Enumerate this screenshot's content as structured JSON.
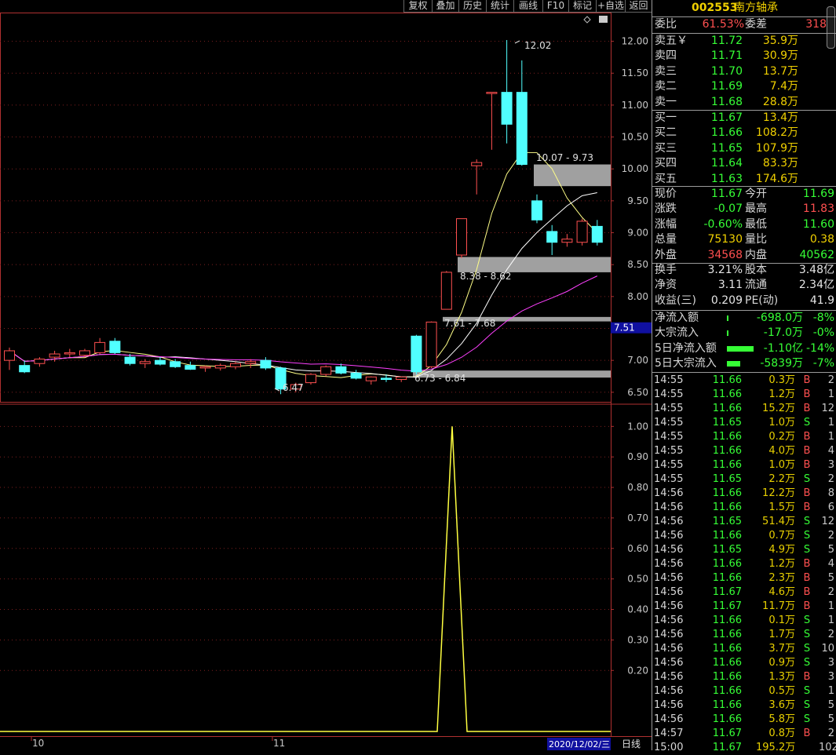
{
  "toolbar": {
    "buttons": [
      "复权",
      "叠加",
      "历史",
      "统计",
      "画线",
      "F10",
      "标记",
      "+自选",
      "返回"
    ]
  },
  "chart_data": [
    {
      "type": "candlestick",
      "y_ticks": [
        "12.00",
        "11.50",
        "11.00",
        "10.50",
        "10.00",
        "9.50",
        "9.00",
        "8.50",
        "8.00",
        "7.50",
        "7.00",
        "6.50"
      ],
      "ylim": [
        6.35,
        12.45
      ],
      "x_labels": [
        "10",
        "11"
      ],
      "candles": [
        {
          "o": 7.0,
          "h": 7.2,
          "l": 6.85,
          "c": 7.15
        },
        {
          "o": 6.92,
          "h": 7.0,
          "l": 6.8,
          "c": 6.82
        },
        {
          "o": 6.95,
          "h": 7.05,
          "l": 6.9,
          "c": 7.02
        },
        {
          "o": 7.05,
          "h": 7.15,
          "l": 6.98,
          "c": 7.1
        },
        {
          "o": 7.1,
          "h": 7.18,
          "l": 7.05,
          "c": 7.12
        },
        {
          "o": 7.08,
          "h": 7.18,
          "l": 7.05,
          "c": 7.15
        },
        {
          "o": 7.12,
          "h": 7.35,
          "l": 7.1,
          "c": 7.28
        },
        {
          "o": 7.3,
          "h": 7.35,
          "l": 7.1,
          "c": 7.12
        },
        {
          "o": 7.05,
          "h": 7.1,
          "l": 6.92,
          "c": 6.95
        },
        {
          "o": 6.95,
          "h": 7.02,
          "l": 6.88,
          "c": 6.98
        },
        {
          "o": 7.0,
          "h": 7.05,
          "l": 6.92,
          "c": 6.94
        },
        {
          "o": 6.98,
          "h": 7.02,
          "l": 6.88,
          "c": 6.9
        },
        {
          "o": 6.92,
          "h": 6.98,
          "l": 6.85,
          "c": 6.86
        },
        {
          "o": 6.88,
          "h": 6.92,
          "l": 6.82,
          "c": 6.9
        },
        {
          "o": 6.88,
          "h": 6.95,
          "l": 6.84,
          "c": 6.92
        },
        {
          "o": 6.9,
          "h": 6.98,
          "l": 6.86,
          "c": 6.95
        },
        {
          "o": 6.95,
          "h": 7.02,
          "l": 6.88,
          "c": 6.98
        },
        {
          "o": 7.0,
          "h": 7.05,
          "l": 6.85,
          "c": 6.88
        },
        {
          "o": 6.88,
          "h": 6.9,
          "l": 6.47,
          "c": 6.55
        },
        {
          "o": 6.55,
          "h": 6.65,
          "l": 6.5,
          "c": 6.62
        },
        {
          "o": 6.65,
          "h": 6.8,
          "l": 6.62,
          "c": 6.78
        },
        {
          "o": 6.78,
          "h": 6.92,
          "l": 6.75,
          "c": 6.9
        },
        {
          "o": 6.9,
          "h": 6.95,
          "l": 6.78,
          "c": 6.8
        },
        {
          "o": 6.8,
          "h": 6.85,
          "l": 6.7,
          "c": 6.72
        },
        {
          "o": 6.68,
          "h": 6.75,
          "l": 6.62,
          "c": 6.74
        },
        {
          "o": 6.72,
          "h": 6.78,
          "l": 6.66,
          "c": 6.7
        },
        {
          "o": 6.7,
          "h": 6.75,
          "l": 6.66,
          "c": 6.74
        },
        {
          "o": 7.38,
          "h": 7.4,
          "l": 6.78,
          "c": 6.82
        },
        {
          "o": 6.9,
          "h": 7.61,
          "l": 6.88,
          "c": 7.6
        },
        {
          "o": 7.8,
          "h": 8.4,
          "l": 7.8,
          "c": 8.38
        },
        {
          "o": 8.65,
          "h": 9.22,
          "l": 8.6,
          "c": 9.22
        },
        {
          "o": 10.05,
          "h": 10.15,
          "l": 9.6,
          "c": 10.1
        },
        {
          "o": 11.2,
          "h": 11.2,
          "l": 10.3,
          "c": 11.2
        },
        {
          "o": 11.2,
          "h": 12.02,
          "l": 10.4,
          "c": 10.7
        },
        {
          "o": 11.2,
          "h": 11.7,
          "l": 10.05,
          "c": 10.07
        },
        {
          "o": 9.5,
          "h": 9.6,
          "l": 9.15,
          "c": 9.2
        },
        {
          "o": 9.02,
          "h": 9.12,
          "l": 8.65,
          "c": 8.85
        },
        {
          "o": 8.85,
          "h": 8.98,
          "l": 8.78,
          "c": 8.9
        },
        {
          "o": 8.85,
          "h": 9.22,
          "l": 8.8,
          "c": 9.18
        },
        {
          "o": 9.1,
          "h": 9.2,
          "l": 8.8,
          "c": 8.85
        }
      ],
      "annotations": [
        "12.02",
        "10.07 - 9.73",
        "8.38 - 8.62",
        "7.61 - 7.68",
        "6.73 - 6.84",
        "6.47"
      ],
      "zones": [
        {
          "low": 9.73,
          "high": 10.07
        },
        {
          "low": 8.38,
          "high": 8.62
        },
        {
          "low": 7.61,
          "high": 7.68
        },
        {
          "low": 6.73,
          "high": 6.84
        }
      ],
      "current_price_label": "7.51"
    },
    {
      "type": "line",
      "y_ticks": [
        "1.00",
        "0.90",
        "0.80",
        "0.70",
        "0.60",
        "0.50",
        "0.40",
        "0.30",
        "0.20"
      ],
      "ylim": [
        0,
        1.06
      ],
      "values": [
        0,
        0,
        0,
        0,
        0,
        0,
        0,
        0,
        0,
        0,
        0,
        0,
        0,
        0,
        0,
        0,
        0,
        0,
        0,
        0,
        0,
        0,
        0,
        0,
        0,
        0,
        0,
        0,
        0,
        1,
        0,
        0,
        0,
        0,
        0,
        0,
        0,
        0,
        0,
        0
      ]
    }
  ],
  "date_bar": {
    "date": "2020/12/02/三",
    "period": "日线"
  },
  "stock": {
    "code": "002553",
    "name": "南方轴承"
  },
  "weibi": {
    "label1": "委比",
    "value1": "61.53%",
    "label2": "委差",
    "value2": "318"
  },
  "sell_orders": [
    {
      "label": "卖五￥",
      "price": "11.72",
      "volume": "35.9万"
    },
    {
      "label": "卖四",
      "price": "11.71",
      "volume": "30.9万"
    },
    {
      "label": "卖三",
      "price": "11.70",
      "volume": "13.7万"
    },
    {
      "label": "卖二",
      "price": "11.69",
      "volume": "7.4万"
    },
    {
      "label": "卖一",
      "price": "11.68",
      "volume": "28.8万"
    }
  ],
  "buy_orders": [
    {
      "label": "买一",
      "price": "11.67",
      "volume": "13.4万"
    },
    {
      "label": "买二",
      "price": "11.66",
      "volume": "108.2万"
    },
    {
      "label": "买三",
      "price": "11.65",
      "volume": "107.9万"
    },
    {
      "label": "买四",
      "price": "11.64",
      "volume": "83.3万"
    },
    {
      "label": "买五",
      "price": "11.63",
      "volume": "174.6万"
    }
  ],
  "quote": [
    {
      "l1": "现价",
      "v1": "11.67",
      "c1": "green",
      "l2": "今开",
      "v2": "11.69",
      "c2": "green"
    },
    {
      "l1": "涨跌",
      "v1": "-0.07",
      "c1": "green",
      "l2": "最高",
      "v2": "11.83",
      "c2": "red"
    },
    {
      "l1": "涨幅",
      "v1": "-0.60%",
      "c1": "green",
      "l2": "最低",
      "v2": "11.60",
      "c2": "green"
    },
    {
      "l1": "总量",
      "v1": "75130",
      "c1": "yellow",
      "l2": "量比",
      "v2": "0.38",
      "c2": "yellow"
    },
    {
      "l1": "外盘",
      "v1": "34568",
      "c1": "red",
      "l2": "内盘",
      "v2": "40562",
      "c2": "green"
    }
  ],
  "fundamentals": [
    {
      "l1": "换手",
      "v1": "3.21%",
      "l2": "股本",
      "v2": "3.48亿"
    },
    {
      "l1": "净资",
      "v1": "3.11",
      "l2": "流通",
      "v2": "2.34亿"
    },
    {
      "l1": "收益(三)",
      "v1": "0.209",
      "l2": "PE(动)",
      "v2": "41.9"
    }
  ],
  "flows": [
    {
      "label": "净流入额",
      "bar": 0.02,
      "value": "-698.0万",
      "pct": "-8%"
    },
    {
      "label": "大宗流入",
      "bar": 0.01,
      "value": "-17.0万",
      "pct": "-0%"
    },
    {
      "label": "5日净流入额",
      "bar": 0.9,
      "value": "-1.10亿",
      "pct": "-14%"
    },
    {
      "label": "5日大宗流入",
      "bar": 0.45,
      "value": "-5839万",
      "pct": "-7%"
    }
  ],
  "colors": {
    "up": "#ff5050",
    "down": "#50ffff",
    "ma5": "#ffff88",
    "ma10": "#ffffff",
    "ma20": "#ff40ff"
  },
  "ticks": [
    {
      "time": "14:55",
      "price": "11.66",
      "vol": "0.3万",
      "bs": "B",
      "n": "2"
    },
    {
      "time": "14:55",
      "price": "11.66",
      "vol": "1.2万",
      "bs": "B",
      "n": "1"
    },
    {
      "time": "14:55",
      "price": "11.66",
      "vol": "15.2万",
      "bs": "B",
      "n": "12"
    },
    {
      "time": "14:55",
      "price": "11.65",
      "vol": "1.0万",
      "bs": "S",
      "n": "1"
    },
    {
      "time": "14:55",
      "price": "11.66",
      "vol": "0.2万",
      "bs": "B",
      "n": "1"
    },
    {
      "time": "14:55",
      "price": "11.66",
      "vol": "4.0万",
      "bs": "B",
      "n": "4"
    },
    {
      "time": "14:55",
      "price": "11.66",
      "vol": "1.0万",
      "bs": "B",
      "n": "3"
    },
    {
      "time": "14:55",
      "price": "11.65",
      "vol": "2.2万",
      "bs": "S",
      "n": "2"
    },
    {
      "time": "14:56",
      "price": "11.66",
      "vol": "12.2万",
      "bs": "B",
      "n": "8"
    },
    {
      "time": "14:56",
      "price": "11.66",
      "vol": "1.5万",
      "bs": "B",
      "n": "6"
    },
    {
      "time": "14:56",
      "price": "11.65",
      "vol": "51.4万",
      "bs": "S",
      "n": "12"
    },
    {
      "time": "14:56",
      "price": "11.66",
      "vol": "0.7万",
      "bs": "S",
      "n": "2"
    },
    {
      "time": "14:56",
      "price": "11.65",
      "vol": "4.9万",
      "bs": "S",
      "n": "5"
    },
    {
      "time": "14:56",
      "price": "11.66",
      "vol": "1.2万",
      "bs": "B",
      "n": "4"
    },
    {
      "time": "14:56",
      "price": "11.66",
      "vol": "2.3万",
      "bs": "B",
      "n": "5"
    },
    {
      "time": "14:56",
      "price": "11.67",
      "vol": "4.6万",
      "bs": "B",
      "n": "2"
    },
    {
      "time": "14:56",
      "price": "11.67",
      "vol": "11.7万",
      "bs": "B",
      "n": "1"
    },
    {
      "time": "14:56",
      "price": "11.66",
      "vol": "0.1万",
      "bs": "S",
      "n": "1"
    },
    {
      "time": "14:56",
      "price": "11.66",
      "vol": "1.7万",
      "bs": "S",
      "n": "2"
    },
    {
      "time": "14:56",
      "price": "11.66",
      "vol": "3.7万",
      "bs": "S",
      "n": "10"
    },
    {
      "time": "14:56",
      "price": "11.66",
      "vol": "0.9万",
      "bs": "S",
      "n": "3"
    },
    {
      "time": "14:56",
      "price": "11.66",
      "vol": "1.3万",
      "bs": "B",
      "n": "3"
    },
    {
      "time": "14:56",
      "price": "11.66",
      "vol": "0.5万",
      "bs": "S",
      "n": "1"
    },
    {
      "time": "14:56",
      "price": "11.66",
      "vol": "3.6万",
      "bs": "S",
      "n": "5"
    },
    {
      "time": "14:56",
      "price": "11.66",
      "vol": "5.8万",
      "bs": "S",
      "n": "5"
    },
    {
      "time": "14:57",
      "price": "11.67",
      "vol": "0.8万",
      "bs": "B",
      "n": "2"
    },
    {
      "time": "15:00",
      "price": "11.67",
      "vol": "195.2万",
      "bs": "",
      "n": "102"
    }
  ]
}
